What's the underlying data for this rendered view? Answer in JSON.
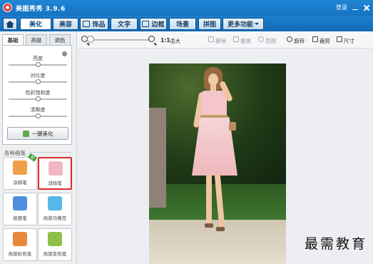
{
  "app": {
    "title": "美图秀秀 3.9.6",
    "login": "登录"
  },
  "main_tabs": [
    {
      "label": "美化",
      "active": true
    },
    {
      "label": "美容",
      "active": false
    },
    {
      "label": "饰品",
      "active": false
    },
    {
      "label": "文字",
      "active": false
    },
    {
      "label": "边框",
      "active": false
    },
    {
      "label": "场景",
      "active": false
    },
    {
      "label": "拼图",
      "active": false
    },
    {
      "label": "更多功能",
      "active": false
    }
  ],
  "toolbar": {
    "zoom_one_to_one": "1:1",
    "zoom_fit": "适大",
    "undo": "撤销",
    "redo": "重做",
    "original": "原图",
    "rotate": "旋转",
    "crop": "裁剪",
    "resize": "尺寸"
  },
  "left_panel": {
    "sub_tabs": [
      {
        "label": "基础",
        "active": true
      },
      {
        "label": "高级",
        "active": false
      },
      {
        "label": "调色",
        "active": false
      }
    ],
    "sliders": [
      {
        "label": "亮度",
        "value": 0.5
      },
      {
        "label": "对比度",
        "value": 0.5
      },
      {
        "label": "色彩饱和度",
        "value": 0.5
      },
      {
        "label": "清晰度",
        "value": 0.5
      }
    ],
    "one_key_button": "一键美化",
    "pens_title": "各种画笔",
    "pens": [
      {
        "label": "涂鸦笔",
        "icon": "doodle-pen-icon",
        "badge": "新",
        "color": "#f0a04b",
        "selected": false
      },
      {
        "label": "消除笔",
        "icon": "eraser-pen-icon",
        "badge": "",
        "color": "#f3b6c3",
        "selected": true
      },
      {
        "label": "抠图笔",
        "icon": "cutout-pen-icon",
        "badge": "",
        "color": "#4f8fe0",
        "selected": false
      },
      {
        "label": "局部马赛克",
        "icon": "mosaic-pen-icon",
        "badge": "",
        "color": "#56b7e8",
        "selected": false
      },
      {
        "label": "局部彩色笔",
        "icon": "color-pen-icon",
        "badge": "",
        "color": "#e58a3a",
        "selected": false
      },
      {
        "label": "局部变色笔",
        "icon": "recolor-pen-icon",
        "badge": "",
        "color": "#8fbf4a",
        "selected": false
      }
    ]
  },
  "watermark": "最需教育"
}
